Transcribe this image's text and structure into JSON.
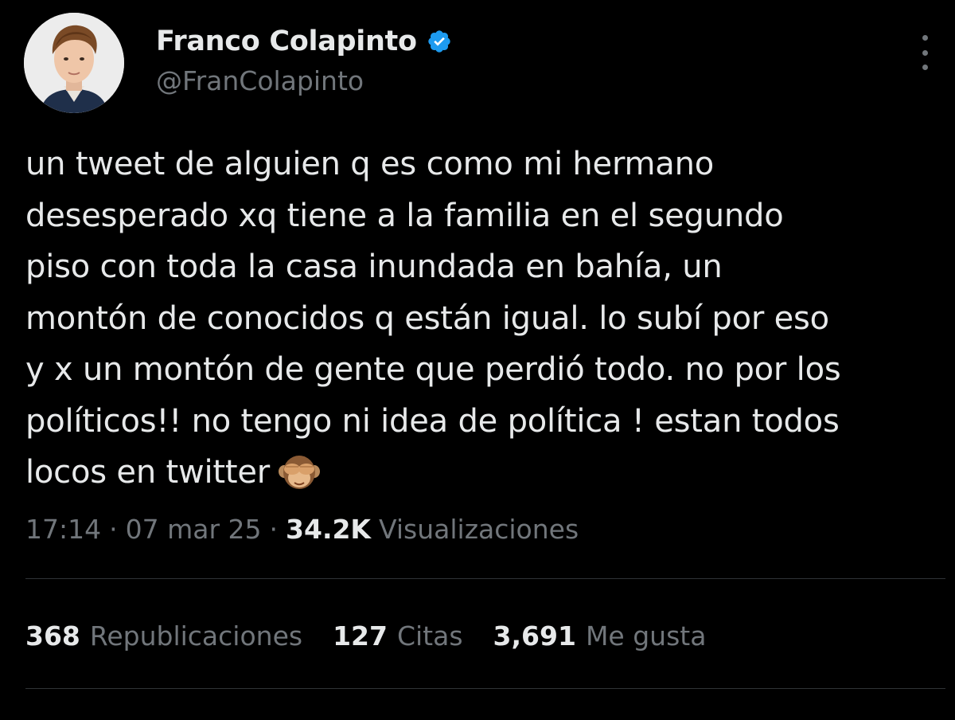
{
  "author": {
    "display_name": "Franco Colapinto",
    "handle": "@FranColapinto",
    "verified_icon": "verified-badge-icon",
    "avatar_icon": "profile-photo"
  },
  "tweet": {
    "lines": [
      "un tweet de alguien q es como mi hermano",
      "desesperado xq tiene a la familia en el segundo",
      "piso con toda la casa inundada en bahía, un",
      "montón de conocidos q están igual. lo subí por eso",
      "y x un montón de gente que perdió todo. no por los",
      "políticos!! no tengo ni idea de política ! estan todos",
      "locos en twitter"
    ],
    "emoji_icon": "see-no-evil-monkey-emoji"
  },
  "meta": {
    "time": "17:14",
    "separator": "·",
    "date": "07 mar 25",
    "views_count": "34.2K",
    "views_label": "Visualizaciones"
  },
  "stats": {
    "reposts_count": "368",
    "reposts_label": "Republicaciones",
    "quotes_count": "127",
    "quotes_label": "Citas",
    "likes_count": "3,691",
    "likes_label": "Me gusta"
  },
  "colors": {
    "background": "#000000",
    "text_primary": "#e7e9ea",
    "text_secondary": "#71767b",
    "verified_blue": "#1d9bf0",
    "divider": "#2f3336"
  }
}
